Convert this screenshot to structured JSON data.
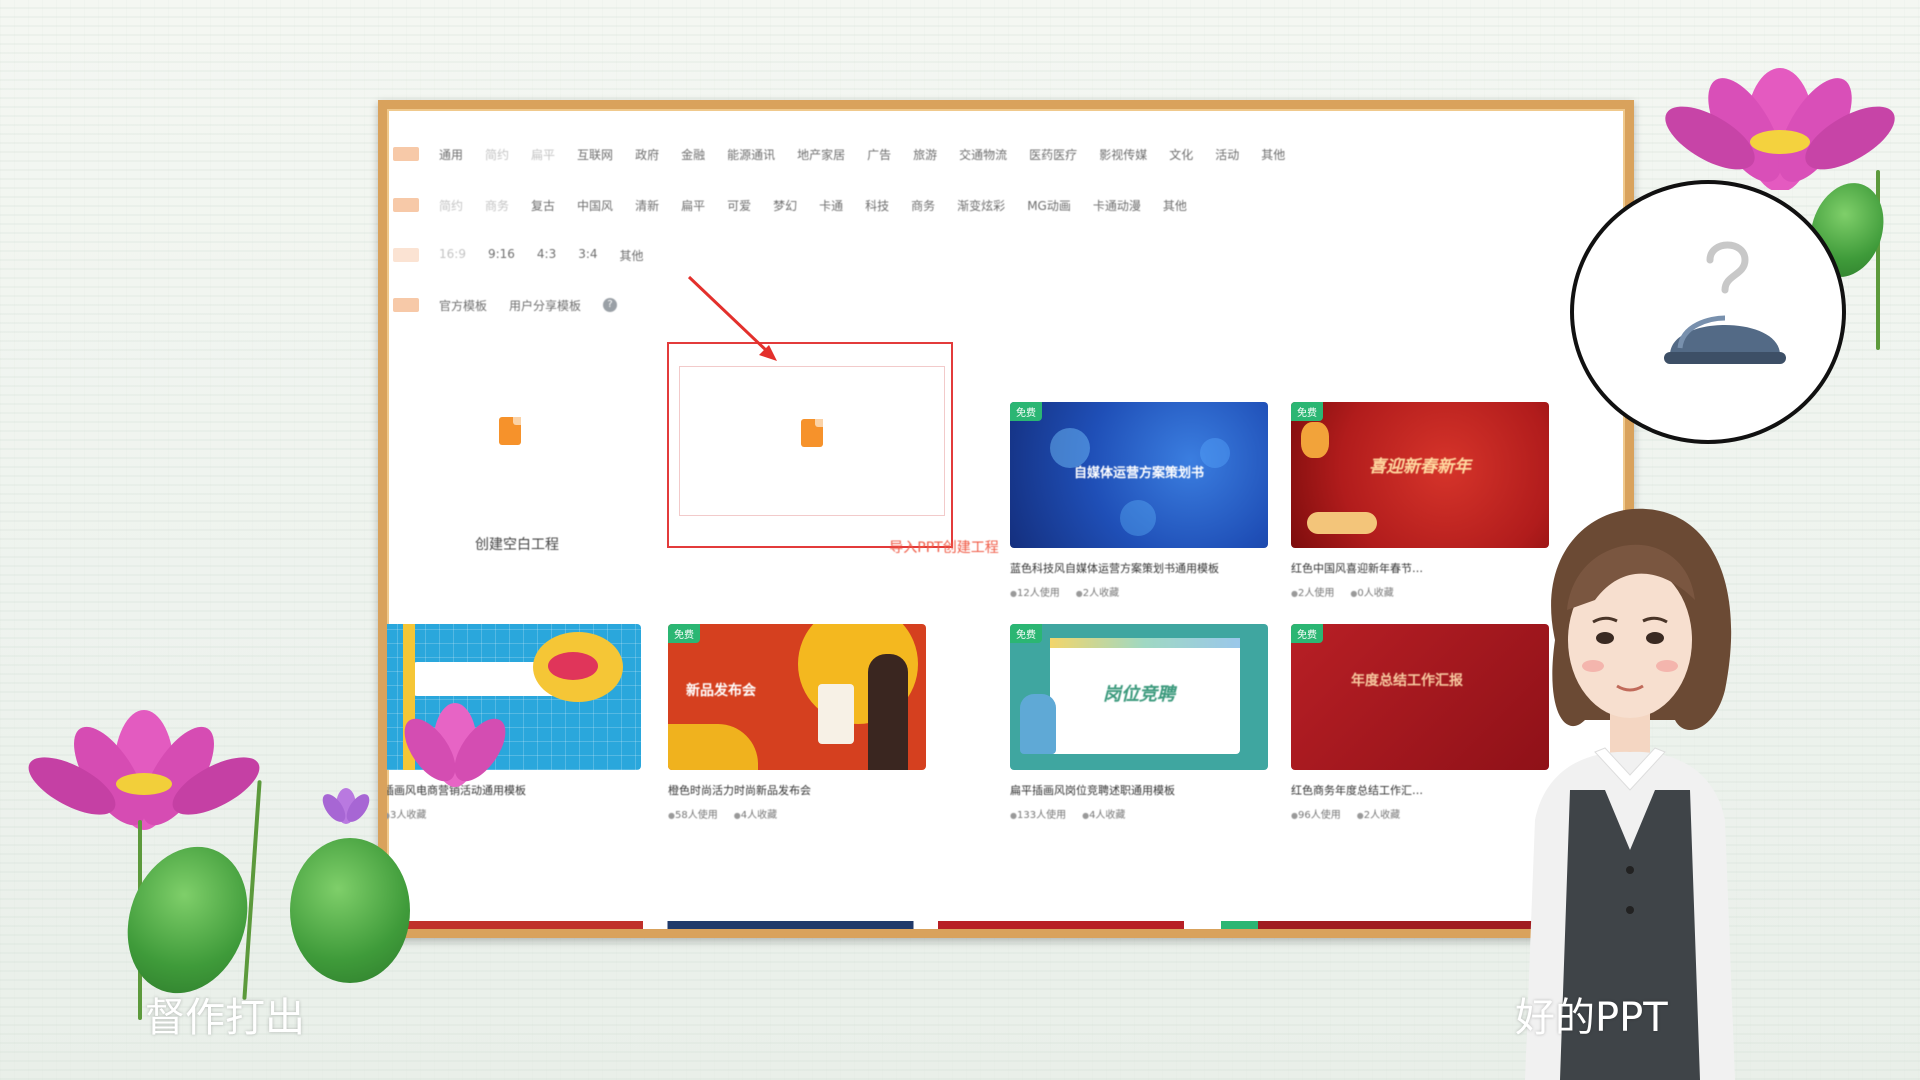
{
  "filters": {
    "row1": [
      {
        "label": "通用",
        "muted": false
      },
      {
        "label": "简约",
        "muted": true
      },
      {
        "label": "扁平",
        "muted": true
      },
      {
        "label": "互联网",
        "muted": false
      },
      {
        "label": "政府",
        "muted": false
      },
      {
        "label": "金融",
        "muted": false
      },
      {
        "label": "能源通讯",
        "muted": false
      },
      {
        "label": "地产家居",
        "muted": false
      },
      {
        "label": "广告",
        "muted": false
      },
      {
        "label": "旅游",
        "muted": false
      },
      {
        "label": "交通物流",
        "muted": false
      },
      {
        "label": "医药医疗",
        "muted": false
      },
      {
        "label": "影视传媒",
        "muted": false
      },
      {
        "label": "文化",
        "muted": false
      },
      {
        "label": "活动",
        "muted": false
      },
      {
        "label": "其他",
        "muted": false
      }
    ],
    "row2": [
      {
        "label": "简约",
        "muted": true
      },
      {
        "label": "商务",
        "muted": true
      },
      {
        "label": "复古",
        "muted": false
      },
      {
        "label": "中国风",
        "muted": false
      },
      {
        "label": "清新",
        "muted": false
      },
      {
        "label": "扁平",
        "muted": false
      },
      {
        "label": "可爱",
        "muted": false
      },
      {
        "label": "梦幻",
        "muted": false
      },
      {
        "label": "卡通",
        "muted": false
      },
      {
        "label": "科技",
        "muted": false
      },
      {
        "label": "商务",
        "muted": false
      },
      {
        "label": "渐变炫彩",
        "muted": false
      },
      {
        "label": "MG动画",
        "muted": false
      },
      {
        "label": "卡通动漫",
        "muted": false
      },
      {
        "label": "其他",
        "muted": false
      }
    ],
    "row3": [
      {
        "label": "16:9",
        "muted": true
      },
      {
        "label": "9:16",
        "muted": false
      },
      {
        "label": "4:3",
        "muted": false
      },
      {
        "label": "3:4",
        "muted": false
      },
      {
        "label": "其他",
        "muted": false
      }
    ],
    "row4": [
      {
        "label": "官方模板",
        "muted": false
      },
      {
        "label": "用户分享模板",
        "muted": false
      }
    ],
    "help_icon": "?"
  },
  "create_blank": {
    "label": "创建空白工程"
  },
  "import_ppt": {
    "label": "导入PPT创建工程"
  },
  "templates": [
    {
      "badge": "免费",
      "thumb_title": "自媒体运营方案策划书",
      "title": "蓝色科技风自媒体运营方案策划书通用模板",
      "uses": "12人使用",
      "favs": "2人收藏"
    },
    {
      "badge": "免费",
      "thumb_title": "喜迎新春新年",
      "title": "红色中国风喜迎新年春节…",
      "uses": "2人使用",
      "favs": "0人收藏"
    },
    {
      "badge": "",
      "thumb_title": "",
      "title": "插画风电商营销活动通用模板",
      "uses": "",
      "favs": "3人收藏"
    },
    {
      "badge": "免费",
      "thumb_title": "新品发布会",
      "title": "橙色时尚活力时尚新品发布会",
      "uses": "58人使用",
      "favs": "4人收藏"
    },
    {
      "badge": "免费",
      "thumb_title": "岗位竞聘",
      "title": "扁平插画风岗位竞聘述职通用模板",
      "uses": "133人使用",
      "favs": "4人收藏"
    },
    {
      "badge": "免费",
      "thumb_title": "年度总结工作汇报",
      "title": "红色商务年度总结工作汇…",
      "uses": "96人使用",
      "favs": "2人收藏"
    }
  ],
  "captions": {
    "left": "督作打出",
    "right": "好的PPT"
  },
  "colors": {
    "frame": "#d9a25c",
    "accent": "#f05a45",
    "highlight": "#e33b3b",
    "badge": "#2bb673"
  }
}
